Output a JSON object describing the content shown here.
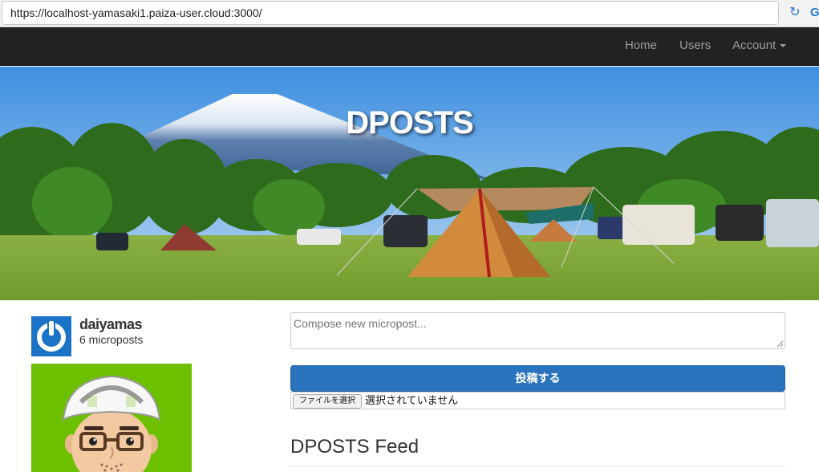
{
  "browser": {
    "url": "https://localhost-yamasaki1.paiza-user.cloud:3000/"
  },
  "navbar": {
    "items": [
      {
        "label": "Home"
      },
      {
        "label": "Users"
      },
      {
        "label": "Account"
      }
    ]
  },
  "hero": {
    "title": "DPOSTS"
  },
  "user": {
    "name": "daiyamas",
    "micropost_count": "6 microposts"
  },
  "compose": {
    "placeholder": "Compose new micropost...",
    "submit_label": "投稿する",
    "file_button_label": "ファイルを選択",
    "file_status": "選択されていません"
  },
  "feed": {
    "title": "DPOSTS Feed"
  },
  "colors": {
    "navbar_bg": "#222222",
    "primary_button": "#2a74be",
    "avatar_small_bg": "#1b73c7",
    "avatar_large_bg": "#6cc000"
  }
}
